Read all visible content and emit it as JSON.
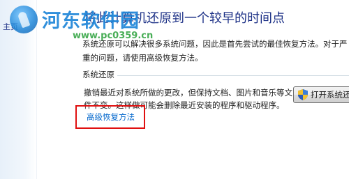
{
  "nav": {
    "home_label": "主页"
  },
  "watermark": {
    "site_name": "河东软件园",
    "url": "www.pc0359.cn"
  },
  "page": {
    "title": "将此计算机还原到一个较早的时间点",
    "description": "系统还原可以解决很多系统问题，因此是首先尝试的最佳恢复方法。对于严重的问题，请使用高级恢复方法。"
  },
  "system_restore": {
    "group_label": "系统还原",
    "description": "撤销最近对系统所做的更改，但保持文档、图片和音乐等文件不变。这样做可能会删除最近安装的程序和驱动程序。",
    "open_button_label": "打开系统还原"
  },
  "advanced": {
    "link_label": "高级恢复方法"
  },
  "icons": {
    "button_icon": "uac-shield-icon"
  },
  "colors": {
    "title": "#1e3287",
    "link": "#0066cc",
    "highlight": "#e01010"
  }
}
